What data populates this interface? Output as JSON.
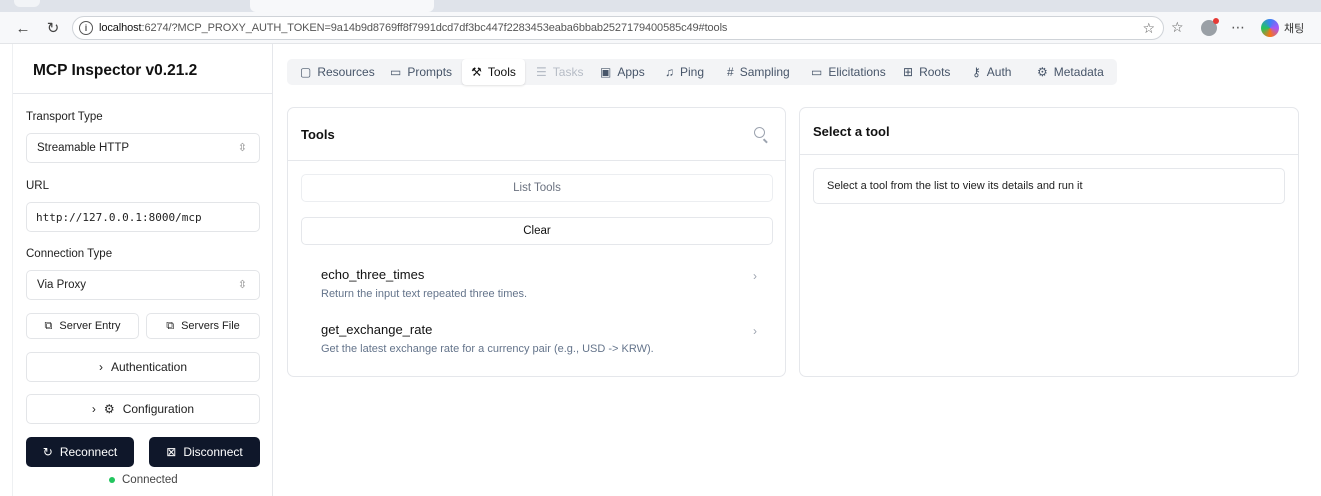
{
  "browser": {
    "url_host": "localhost",
    "url_rest": ":6274/?MCP_PROXY_AUTH_TOKEN=9a14b9d8769ff8f7991dcd7df3bc447f2283453eaba6bbab2527179400585c49#tools",
    "copilot_label": "채팅"
  },
  "sidebar": {
    "app_title": "MCP Inspector v0.21.2",
    "transport_label": "Transport Type",
    "transport_value": "Streamable HTTP",
    "url_label": "URL",
    "url_value": "http://127.0.0.1:8000/mcp",
    "connection_label": "Connection Type",
    "connection_value": "Via Proxy",
    "server_entry": "Server Entry",
    "servers_file": "Servers File",
    "authentication": "Authentication",
    "configuration": "Configuration",
    "reconnect": "Reconnect",
    "disconnect": "Disconnect",
    "status": "Connected",
    "status_color": "#22c55e"
  },
  "nav": {
    "resources": "Resources",
    "prompts": "Prompts",
    "tools": "Tools",
    "tasks": "Tasks",
    "apps": "Apps",
    "ping": "Ping",
    "sampling": "Sampling",
    "elicitations": "Elicitations",
    "roots": "Roots",
    "auth": "Auth",
    "metadata": "Metadata"
  },
  "tools_panel": {
    "title": "Tools",
    "list_tools": "List Tools",
    "clear": "Clear",
    "items": [
      {
        "name": "echo_three_times",
        "description": "Return the input text repeated three times."
      },
      {
        "name": "get_exchange_rate",
        "description": "Get the latest exchange rate for a currency pair (e.g., USD -> KRW)."
      }
    ]
  },
  "detail_panel": {
    "title": "Select a tool",
    "placeholder": "Select a tool from the list to view its details and run it"
  },
  "colors": {
    "dark_button": "#0f172a",
    "active_tab_bg": "#ffffff",
    "nav_bg": "#f3f4f6"
  }
}
